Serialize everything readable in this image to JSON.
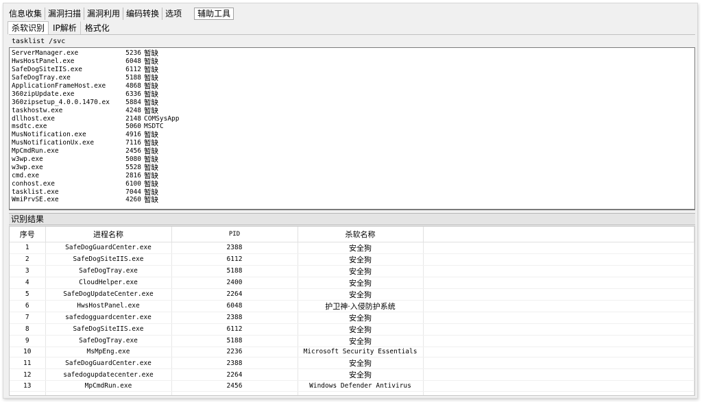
{
  "menubar": {
    "items": [
      "信息收集",
      "漏洞扫描",
      "漏洞利用",
      "编码转换",
      "选项"
    ],
    "active": "辅助工具"
  },
  "subtabs": [
    "杀软识别",
    "IP解析",
    "格式化"
  ],
  "command": {
    "value": "tasklist /svc"
  },
  "output": [
    {
      "name": "ServerManager.exe",
      "pid": "5236",
      "svc": "暂缺"
    },
    {
      "name": "HwsHostPanel.exe",
      "pid": "6048",
      "svc": "暂缺"
    },
    {
      "name": "SafeDogSiteIIS.exe",
      "pid": "6112",
      "svc": "暂缺"
    },
    {
      "name": "SafeDogTray.exe",
      "pid": "5188",
      "svc": "暂缺"
    },
    {
      "name": "ApplicationFrameHost.exe",
      "pid": "4868",
      "svc": "暂缺"
    },
    {
      "name": "360zipUpdate.exe",
      "pid": "6336",
      "svc": "暂缺"
    },
    {
      "name": "360zipsetup_4.0.0.1470.ex",
      "pid": "5884",
      "svc": "暂缺"
    },
    {
      "name": "taskhostw.exe",
      "pid": "4248",
      "svc": "暂缺"
    },
    {
      "name": "dllhost.exe",
      "pid": "2148",
      "svc": "COMSysApp"
    },
    {
      "name": "msdtc.exe",
      "pid": "5060",
      "svc": "MSDTC"
    },
    {
      "name": "MusNotification.exe",
      "pid": "4916",
      "svc": "暂缺"
    },
    {
      "name": "MusNotificationUx.exe",
      "pid": "7116",
      "svc": "暂缺"
    },
    {
      "name": "MpCmdRun.exe",
      "pid": "2456",
      "svc": "暂缺"
    },
    {
      "name": "w3wp.exe",
      "pid": "5080",
      "svc": "暂缺"
    },
    {
      "name": "w3wp.exe",
      "pid": "5528",
      "svc": "暂缺"
    },
    {
      "name": "cmd.exe",
      "pid": "2816",
      "svc": "暂缺"
    },
    {
      "name": "conhost.exe",
      "pid": "6100",
      "svc": "暂缺"
    },
    {
      "name": "tasklist.exe",
      "pid": "7044",
      "svc": "暂缺"
    },
    {
      "name": "WmiPrvSE.exe",
      "pid": "4260",
      "svc": "暂缺"
    }
  ],
  "result": {
    "title": "识别结果",
    "columns": [
      "序号",
      "进程名称",
      "PID",
      "杀软名称"
    ],
    "rows": [
      {
        "no": "1",
        "process": "SafeDogGuardCenter.exe",
        "pid": "2388",
        "av": "安全狗"
      },
      {
        "no": "2",
        "process": "SafeDogSiteIIS.exe",
        "pid": "6112",
        "av": "安全狗"
      },
      {
        "no": "3",
        "process": "SafeDogTray.exe",
        "pid": "5188",
        "av": "安全狗"
      },
      {
        "no": "4",
        "process": "CloudHelper.exe",
        "pid": "2400",
        "av": "安全狗"
      },
      {
        "no": "5",
        "process": "SafeDogUpdateCenter.exe",
        "pid": "2264",
        "av": "安全狗"
      },
      {
        "no": "6",
        "process": "HwsHostPanel.exe",
        "pid": "6048",
        "av": "护卫神·入侵防护系统"
      },
      {
        "no": "7",
        "process": "safedogguardcenter.exe",
        "pid": "2388",
        "av": "安全狗"
      },
      {
        "no": "8",
        "process": "SafeDogSiteIIS.exe",
        "pid": "6112",
        "av": "安全狗"
      },
      {
        "no": "9",
        "process": "SafeDogTray.exe",
        "pid": "5188",
        "av": "安全狗"
      },
      {
        "no": "10",
        "process": "MsMpEng.exe",
        "pid": "2236",
        "av": "Microsoft Security Essentials"
      },
      {
        "no": "11",
        "process": "SafeDogGuardCenter.exe",
        "pid": "2388",
        "av": "安全狗"
      },
      {
        "no": "12",
        "process": "safedogupdatecenter.exe",
        "pid": "2264",
        "av": "安全狗"
      },
      {
        "no": "13",
        "process": "MpCmdRun.exe",
        "pid": "2456",
        "av": "Windows Defender Antivirus"
      }
    ]
  }
}
